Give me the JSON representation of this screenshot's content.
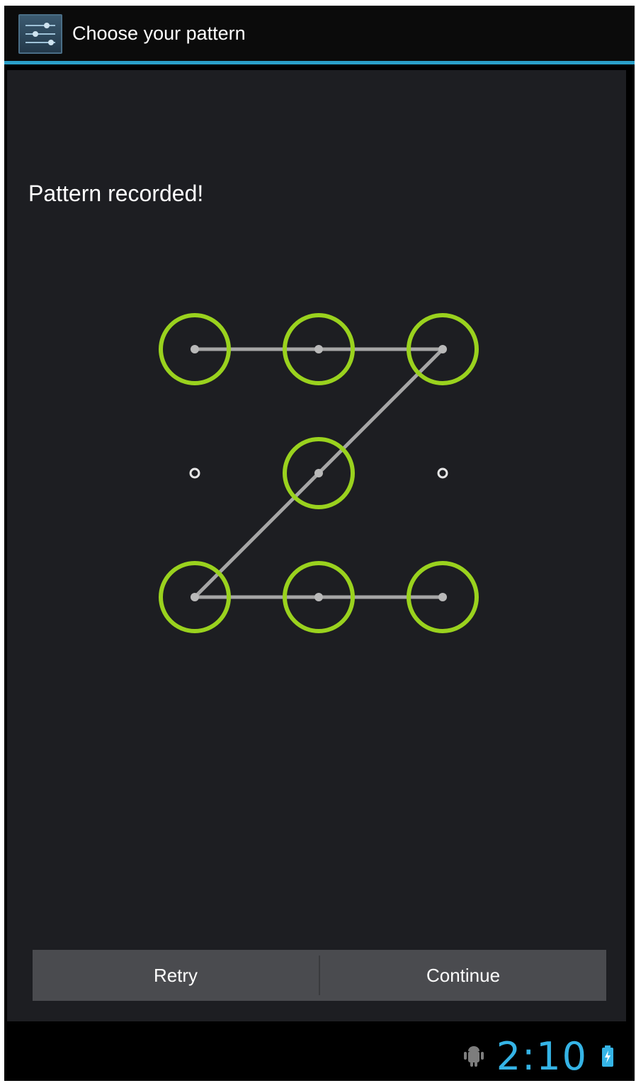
{
  "action_bar": {
    "title": "Choose your pattern",
    "icon": "settings-sliders-icon",
    "accent_color": "#2a9fc8"
  },
  "content": {
    "header": "Pattern recorded!"
  },
  "pattern": {
    "grid_size": 3,
    "selected_cells": [
      1,
      2,
      3,
      5,
      7,
      8,
      9
    ],
    "draw_order": [
      1,
      2,
      3,
      5,
      7,
      8,
      9
    ],
    "ring_color": "#9ad21e",
    "line_color": "#a6a6a6"
  },
  "buttons": {
    "retry": "Retry",
    "continue": "Continue"
  },
  "status_bar": {
    "time": "2:10",
    "icons": [
      "android-debug-icon",
      "battery-charging-icon"
    ],
    "clock_color": "#35b4e6"
  }
}
